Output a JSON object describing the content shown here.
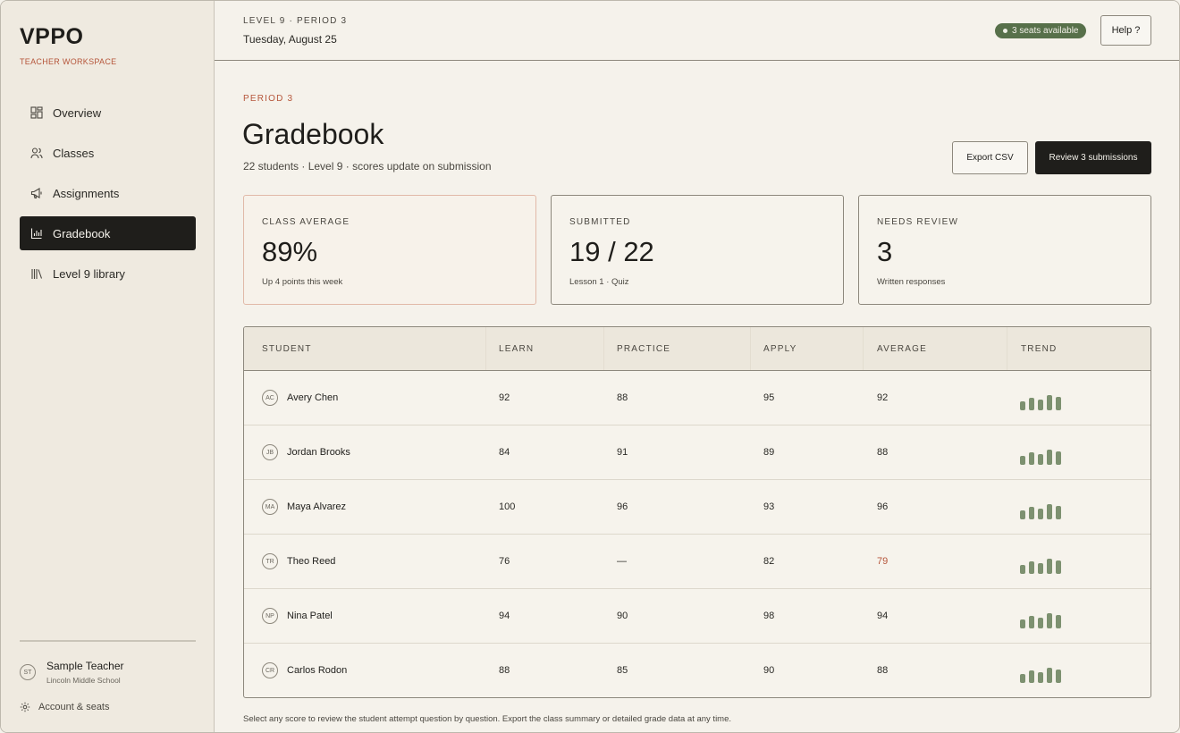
{
  "sidebar": {
    "brand": "VPPO",
    "brand_sub": "TEACHER WORKSPACE",
    "items": [
      {
        "label": "Overview",
        "icon": "grid-icon",
        "active": false
      },
      {
        "label": "Classes",
        "icon": "users-icon",
        "active": false
      },
      {
        "label": "Assignments",
        "icon": "megaphone-icon",
        "active": false
      },
      {
        "label": "Gradebook",
        "icon": "bar-chart-icon",
        "active": true
      },
      {
        "label": "Level 9 library",
        "icon": "library-icon",
        "active": false
      }
    ],
    "user": {
      "initials": "ST",
      "name": "Sample Teacher",
      "school": "Lincoln Middle School"
    },
    "account_label": "Account & seats"
  },
  "topbar": {
    "level": "LEVEL 9 · PERIOD 3",
    "date": "Tuesday, August 25",
    "seats": "3 seats available",
    "help": "Help ?"
  },
  "main": {
    "eyebrow": "PERIOD 3",
    "title": "Gradebook",
    "subtitle": "22 students · Level 9 · scores update on submission",
    "export_label": "Export CSV",
    "review_label": "Review 3 submissions"
  },
  "stats": [
    {
      "label": "CLASS AVERAGE",
      "value": "89%",
      "note": "Up 4 points this week"
    },
    {
      "label": "SUBMITTED",
      "value": "19 / 22",
      "note": "Lesson 1 · Quiz"
    },
    {
      "label": "NEEDS REVIEW",
      "value": "3",
      "note": "Written responses"
    }
  ],
  "table": {
    "columns": [
      "STUDENT",
      "LEARN",
      "PRACTICE",
      "APPLY",
      "AVERAGE",
      "TREND"
    ],
    "rows": [
      {
        "initials": "AC",
        "name": "Avery Chen",
        "learn": "92",
        "practice": "88",
        "apply": "95",
        "average": "92",
        "flag": false
      },
      {
        "initials": "JB",
        "name": "Jordan Brooks",
        "learn": "84",
        "practice": "91",
        "apply": "89",
        "average": "88",
        "flag": false
      },
      {
        "initials": "MA",
        "name": "Maya Alvarez",
        "learn": "100",
        "practice": "96",
        "apply": "93",
        "average": "96",
        "flag": false
      },
      {
        "initials": "TR",
        "name": "Theo Reed",
        "learn": "76",
        "practice": "—",
        "apply": "82",
        "average": "79",
        "flag": true
      },
      {
        "initials": "NP",
        "name": "Nina Patel",
        "learn": "94",
        "practice": "90",
        "apply": "98",
        "average": "94",
        "flag": false
      },
      {
        "initials": "CR",
        "name": "Carlos Rodon",
        "learn": "88",
        "practice": "85",
        "apply": "90",
        "average": "88",
        "flag": false
      }
    ]
  },
  "footnote": "Select any score to review the student attempt question by question. Export the class summary or detailed grade data at any time.",
  "colors": {
    "accent": "#b5553a",
    "trend": "#7d9170",
    "seats": "#57704a",
    "dark": "#1f1e1b"
  }
}
